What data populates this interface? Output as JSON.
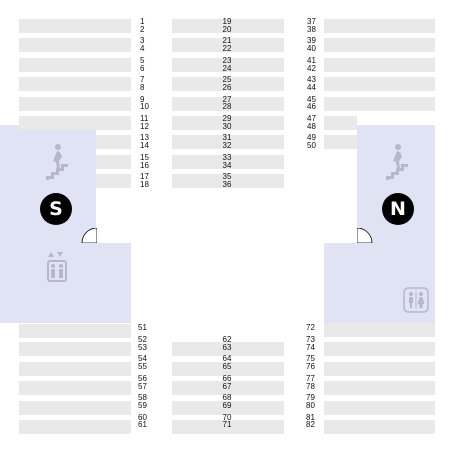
{
  "stations": {
    "south_label": "S",
    "north_label": "N"
  },
  "colors": {
    "zone": "#e0e3f3",
    "seat_bar": "#e9e9e9",
    "icon": "#b7b7c9",
    "badge": "#000000"
  },
  "icons": [
    "stairs-icon",
    "elevator-icon",
    "stairs-icon",
    "restroom-icon"
  ],
  "seat_numbers": {
    "col_a": [
      "1",
      "2",
      "3",
      "4",
      "5",
      "6",
      "7",
      "8",
      "9",
      "10",
      "11",
      "12",
      "13",
      "14",
      "15",
      "16",
      "17",
      "18"
    ],
    "col_a_lower": [
      "51",
      "52",
      "53",
      "54",
      "55",
      "56",
      "57",
      "58",
      "59",
      "60",
      "61"
    ],
    "col_b": [
      "19",
      "20",
      "21",
      "22",
      "23",
      "24",
      "25",
      "26",
      "27",
      "28",
      "29",
      "30",
      "31",
      "32",
      "33",
      "34",
      "35",
      "36"
    ],
    "col_b_lower": [
      "62",
      "63",
      "64",
      "65",
      "66",
      "67",
      "68",
      "69",
      "70",
      "71"
    ],
    "col_c": [
      "37",
      "38",
      "39",
      "40",
      "41",
      "42",
      "43",
      "44",
      "45",
      "46",
      "47",
      "48",
      "49",
      "50"
    ],
    "col_c_lower": [
      "72",
      "73",
      "74",
      "75",
      "76",
      "77",
      "78",
      "79",
      "80",
      "81",
      "82"
    ]
  }
}
